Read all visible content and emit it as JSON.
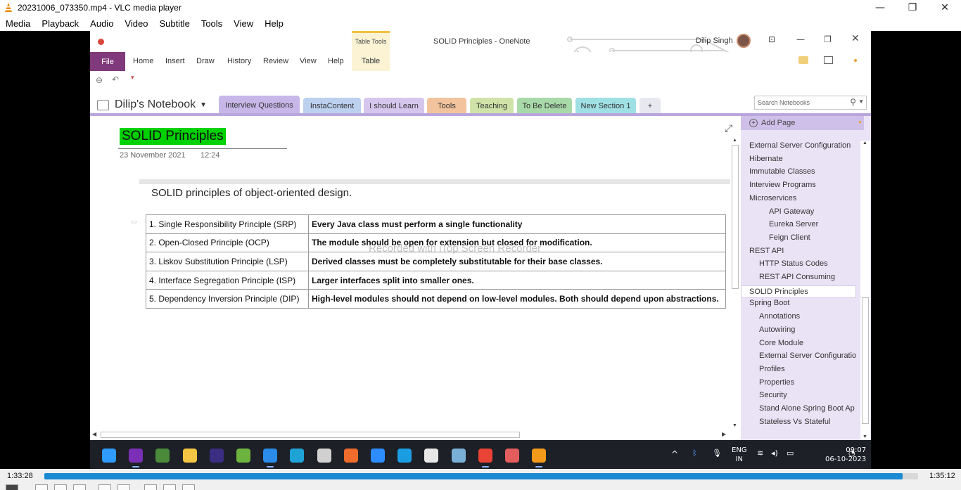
{
  "vlc": {
    "window_title": "20231006_073350.mp4 - VLC media player",
    "menu": [
      "Media",
      "Playback",
      "Audio",
      "Video",
      "Subtitle",
      "Tools",
      "View",
      "Help"
    ],
    "time_current": "1:33:28",
    "time_total": "1:35:12",
    "progress_fraction": 0.982,
    "winctl": [
      "—",
      "❐",
      "✕"
    ]
  },
  "onenote": {
    "doc_title": "SOLID Principles  -  OneNote",
    "contextual_tab": "Table Tools",
    "user_name": "Dilip Singh",
    "ribbon": {
      "file": "File",
      "tabs": [
        "Home",
        "Insert",
        "Draw",
        "History",
        "Review",
        "View",
        "Help"
      ],
      "table_tab": "Table"
    },
    "notebook_name": "Dilip's Notebook",
    "sections": [
      {
        "label": "Interview Questions",
        "color": "#c6b7e8"
      },
      {
        "label": "InstaContent",
        "color": "#bcd0ef"
      },
      {
        "label": "I should Learn",
        "color": "#d5c6ee"
      },
      {
        "label": "Tools",
        "color": "#f2c39c"
      },
      {
        "label": "Teaching",
        "color": "#cfe3a8"
      },
      {
        "label": "To Be Delete",
        "color": "#a8d9a9"
      },
      {
        "label": "New Section 1",
        "color": "#9fe0e4"
      },
      {
        "label": "+",
        "color": "#e8e8f0"
      }
    ],
    "search_placeholder": "Search Notebooks",
    "page": {
      "title": "SOLID Principles",
      "date": "23 November 2021",
      "time": "12:24",
      "heading": "SOLID principles of object-oriented design.",
      "rows": [
        {
          "principle": "1. Single Responsibility Principle (SRP)",
          "desc": "Every Java class must perform a single functionality"
        },
        {
          "principle": "2. Open-Closed Principle (OCP)",
          "desc": "The module should be open for extension but closed for modification."
        },
        {
          "principle": "3. Liskov Substitution Principle (LSP)",
          "desc": "Derived classes must be completely substitutable for their base classes."
        },
        {
          "principle": "4. Interface Segregation Principle (ISP)",
          "desc": "Larger interfaces split into smaller ones."
        },
        {
          "principle": "5. Dependency Inversion Principle (DIP)",
          "desc": "High-level modules should not depend on low-level modules. Both should depend upon abstractions."
        }
      ],
      "watermark": "Recorded with iTop Screen Recorder"
    },
    "pages_pane": {
      "add_page": "Add Page",
      "items": [
        {
          "label": "External Server Configuration",
          "level": 0
        },
        {
          "label": "Hibernate",
          "level": 0
        },
        {
          "label": "Immutable Classes",
          "level": 0
        },
        {
          "label": "Interview Programs",
          "level": 0
        },
        {
          "label": "Microservices",
          "level": 0
        },
        {
          "label": "API Gateway",
          "level": 2
        },
        {
          "label": "Eureka Server",
          "level": 2
        },
        {
          "label": "Feign Client",
          "level": 2
        },
        {
          "label": "REST API",
          "level": 0
        },
        {
          "label": "HTTP Status Codes",
          "level": 1
        },
        {
          "label": "REST API Consuming",
          "level": 1
        },
        {
          "label": "SOLID Principles",
          "level": 0,
          "selected": true
        },
        {
          "label": "Spring Boot",
          "level": 0
        },
        {
          "label": "Annotations",
          "level": 1
        },
        {
          "label": "Autowiring",
          "level": 1
        },
        {
          "label": "Core Module",
          "level": 1
        },
        {
          "label": "External Server Configuratio",
          "level": 1
        },
        {
          "label": "Profiles",
          "level": 1
        },
        {
          "label": "Properties",
          "level": 1
        },
        {
          "label": "Security",
          "level": 1
        },
        {
          "label": "Stand Alone Spring Boot Ap",
          "level": 1
        },
        {
          "label": "Stateless Vs Stateful",
          "level": 1
        }
      ]
    }
  },
  "taskbar": {
    "icons": [
      {
        "name": "windows-start-icon",
        "color": "#2f9bff"
      },
      {
        "name": "onenote-icon",
        "color": "#7b2fb6",
        "active": true
      },
      {
        "name": "notepad-icon",
        "color": "#4a8a3a"
      },
      {
        "name": "file-explorer-icon",
        "color": "#f4c542"
      },
      {
        "name": "eclipse-icon",
        "color": "#3b2d82"
      },
      {
        "name": "spring-tool-icon",
        "color": "#6db33f"
      },
      {
        "name": "vscode-icon",
        "color": "#2a8be8",
        "active": true
      },
      {
        "name": "canva-icon",
        "color": "#1fa3d6"
      },
      {
        "name": "app-icon",
        "color": "#d0d0d0"
      },
      {
        "name": "postman-icon",
        "color": "#ef6c2c"
      },
      {
        "name": "zoom-icon",
        "color": "#2d8cff"
      },
      {
        "name": "edge-icon",
        "color": "#1b9de2"
      },
      {
        "name": "github-icon",
        "color": "#e8e8e8"
      },
      {
        "name": "network-icon",
        "color": "#7ab0d8"
      },
      {
        "name": "chrome-icon",
        "color": "#e94335",
        "active": true
      },
      {
        "name": "snipping-icon",
        "color": "#e35d5d"
      },
      {
        "name": "sublime-icon",
        "color": "#f49a1a",
        "active": true
      }
    ],
    "lang": "ENG",
    "region": "IN",
    "time": "09:07",
    "date": "06-10-2023"
  }
}
